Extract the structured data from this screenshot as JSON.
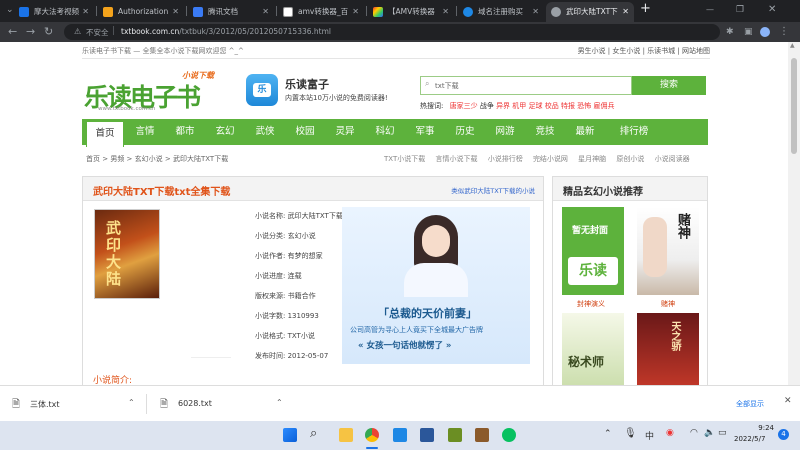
{
  "browser": {
    "tabs": [
      {
        "title": "摩大法考视频"
      },
      {
        "title": "Authorization"
      },
      {
        "title": "腾讯文档"
      },
      {
        "title": "amv转换器_百"
      },
      {
        "title": "【AMV转换器"
      },
      {
        "title": "域名注册购买"
      },
      {
        "title": "武印大陆TXT下"
      }
    ],
    "security_label": "不安全",
    "url_host": "txtbook.com.cn",
    "url_path": "/txtbuk/3/2012/05/2012050715336.html"
  },
  "site": {
    "top_left": "乐读电子书下载 — 全集全本小说下载网欢迎您 ^_^",
    "top_links": [
      "男生小说",
      "女生小说",
      "乐读书城",
      "网站地图"
    ],
    "logo_text": "乐读电子书",
    "logo_tag": "小说下载",
    "logo_url": "www.txtbook.com.cn",
    "app_name": "乐读富子",
    "app_slogan": "内置本站10万小说的免费阅读器!",
    "search_placeholder": "txt下载",
    "search_button": "搜索",
    "hot_label": "热搜词:",
    "hot_words": [
      "唐家三少",
      "战争",
      "异界",
      "机甲",
      "足球",
      "校品",
      "特报",
      "恐怖",
      "雇佣兵"
    ],
    "nav": [
      "首页",
      "言情",
      "都市",
      "玄幻",
      "武侠",
      "校园",
      "灵异",
      "科幻",
      "军事",
      "历史",
      "网游",
      "竞技",
      "最新",
      "排行榜"
    ],
    "breadcrumb": [
      "首页",
      "男频",
      "玄幻小说",
      "武印大陆TXT下载"
    ],
    "sub_links": [
      "TXT小说下载",
      "言情小说下载",
      "小说排行榜",
      "完结小说网",
      "星月神脑",
      "原创小说",
      "小说阅读器"
    ],
    "book_title": "武印大陆TXT下载txt全集下载",
    "similar_link": "类似武印大陆TXT下载的小说",
    "cover_text": "武印大陆",
    "details": [
      {
        "k": "小说名称:",
        "v": "武印大陆TXT下载"
      },
      {
        "k": "小说分类:",
        "v": "玄幻小说"
      },
      {
        "k": "小说作者:",
        "v": "有梦的想家"
      },
      {
        "k": "小说进度:",
        "v": "连载"
      },
      {
        "k": "版权来源:",
        "v": "书籍合作"
      },
      {
        "k": "小说字数:",
        "v": "1310993"
      },
      {
        "k": "小说格式:",
        "v": "TXT小说"
      },
      {
        "k": "发布时间:",
        "v": "2012-05-07"
      }
    ],
    "ad_title": "「总裁的天价前妻」",
    "ad_line1": "公司高管为寻心上人竟买下全城最大广告牌",
    "ad_line2": "« 女孩一句话他就愣了 »",
    "intro_label": "小说简介:",
    "recommend_title": "精品玄幻小说推荐",
    "rec_items": [
      {
        "title": "封神演义",
        "cover": "暂无封面"
      },
      {
        "title": "赌神",
        "cover": "赌神"
      },
      {
        "title": "",
        "cover": "秘术师"
      },
      {
        "title": "",
        "cover": "天之骄"
      }
    ]
  },
  "downloads": {
    "items": [
      {
        "name": "三体.txt"
      },
      {
        "name": "6028.txt"
      }
    ],
    "show_all": "全部显示"
  },
  "taskbar": {
    "ime": "中",
    "time": "9:24",
    "date": "2022/5/7",
    "badge": "4"
  }
}
